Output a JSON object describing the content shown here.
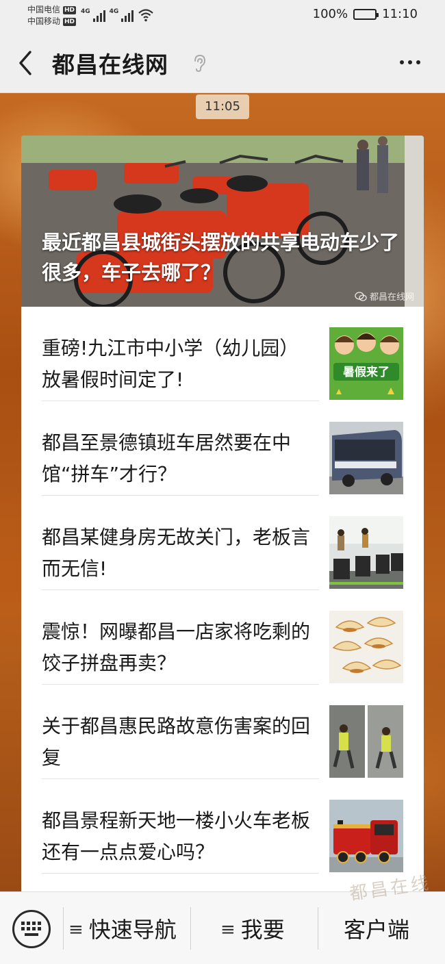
{
  "status_bar": {
    "carrier1": "中国电信",
    "carrier2": "中国移动",
    "hd": "HD",
    "net1": "4G",
    "net2": "4G",
    "battery_percent": "100%",
    "battery_level": 1.0,
    "time": "11:10"
  },
  "nav": {
    "title": "都昌在线网"
  },
  "chat": {
    "timestamp": "11:05"
  },
  "hero": {
    "title": "最近都昌县城街头摆放的共享电动车少了很多，车子去哪了？",
    "watermark": "都昌在线网",
    "watermark_url": "www.duchang.org"
  },
  "articles": [
    {
      "title": "重磅!九江市中小学（幼儿园）放暑假时间定了!",
      "thumb_icon": "summer-vacation-thumb",
      "thumb_text": "暑假来了"
    },
    {
      "title": "都昌至景德镇班车居然要在中馆“拼车”才行？",
      "thumb_icon": "bus-thumb"
    },
    {
      "title": "都昌某健身房无故关门，老板言而无信!",
      "thumb_icon": "gym-thumb"
    },
    {
      "title": "震惊！网曝都昌一店家将吃剩的饺子拼盘再卖？",
      "thumb_icon": "dumplings-thumb"
    },
    {
      "title": "关于都昌惠民路故意伤害案的回复",
      "thumb_icon": "street-fight-thumb"
    },
    {
      "title": "都昌景程新天地一楼小火车老板还有一点点爱心吗？",
      "thumb_icon": "toy-train-thumb"
    }
  ],
  "bottom_bar": {
    "menu1": "快速导航",
    "menu2": "我要",
    "menu3": "客户端",
    "menu_glyph": "≡",
    "watermark": "都昌在线"
  },
  "colors": {
    "chat_bg": "#b35a18",
    "card_bg": "#ffffff",
    "bar_bg": "#efefef",
    "hero_title": "#ffffff"
  }
}
